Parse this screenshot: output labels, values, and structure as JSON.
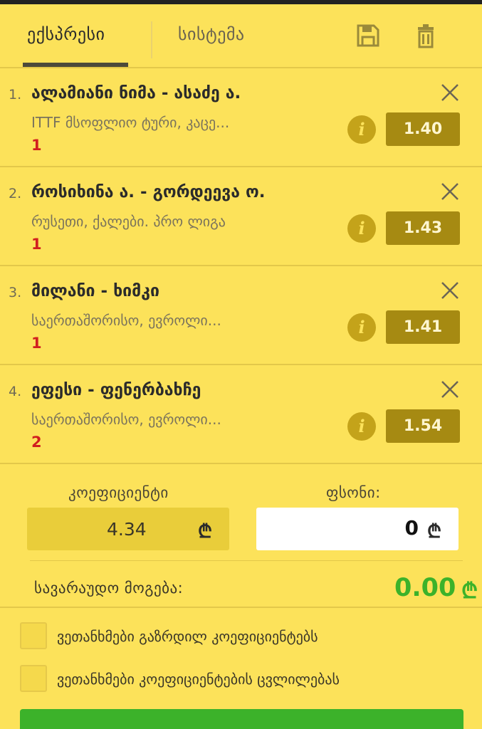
{
  "tabs": {
    "express": "ექსპრესი",
    "system": "სისტემა",
    "save_icon": "save-icon",
    "trash_icon": "trash-icon"
  },
  "bets": [
    {
      "num": "1.",
      "title": "ალამიანი ნიმა - ასაძე ა.",
      "league": "ITTF მსოფლიო ტური, კაცე...",
      "pick": "1",
      "odds": "1.40"
    },
    {
      "num": "2.",
      "title": "როსიხინა ა. - გორდეევა ო.",
      "league": "რუსეთი, ქალები. პრო ლიგა",
      "pick": "1",
      "odds": "1.43"
    },
    {
      "num": "3.",
      "title": "მილანი - ხიმკი",
      "league": "საერთაშორისო, ევროლი...",
      "pick": "1",
      "odds": "1.41"
    },
    {
      "num": "4.",
      "title": "ეფესი - ფენერბახჩე",
      "league": "საერთაშორისო, ევროლი...",
      "pick": "2",
      "odds": "1.54"
    }
  ],
  "summary": {
    "coef_label": "კოეფიციენტი",
    "coef_value": "4.34",
    "stake_label": "ფსონი:",
    "stake_value": "0",
    "currency": "₾",
    "win_label": "სავარაუდო მოგება:",
    "win_value": "0.00"
  },
  "checks": [
    {
      "label": "ვეთანხმები გაზრდილ კოეფიციენტებს"
    },
    {
      "label": "ვეთანხმები კოეფიციენტების ცვლილებას"
    }
  ],
  "colors": {
    "background": "#fce25a",
    "odds_bg": "#a68a12",
    "win_green": "#3cb22a",
    "pick_red": "#d11f1f"
  }
}
